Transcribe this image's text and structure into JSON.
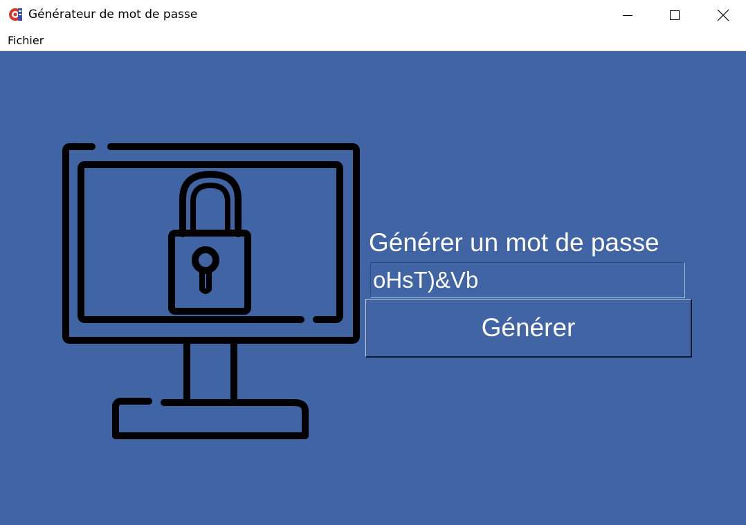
{
  "window": {
    "title": "Générateur de mot de passe"
  },
  "menubar": {
    "items": [
      {
        "label": "Fichier"
      }
    ]
  },
  "main": {
    "heading": "Générer un mot de passe",
    "password_value": "oHsT)&Vb",
    "generate_label": "Générer",
    "illustration_icon": "monitor-padlock-icon"
  },
  "colors": {
    "background": "#4064a4",
    "text": "#ffffff",
    "icon_stroke": "#000000"
  }
}
